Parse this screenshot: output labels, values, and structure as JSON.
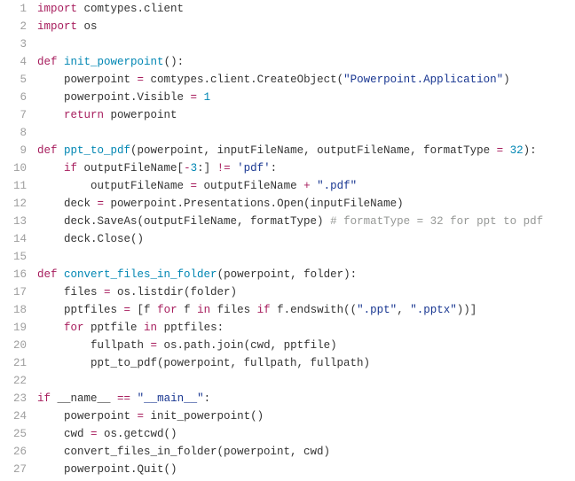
{
  "lines": [
    {
      "num": "1",
      "tokens": [
        [
          "kw",
          "import"
        ],
        [
          "ident",
          " comtypes.client"
        ]
      ]
    },
    {
      "num": "2",
      "tokens": [
        [
          "kw",
          "import"
        ],
        [
          "ident",
          " os"
        ]
      ]
    },
    {
      "num": "3",
      "tokens": []
    },
    {
      "num": "4",
      "tokens": [
        [
          "kw",
          "def"
        ],
        [
          "ident",
          " "
        ],
        [
          "fn",
          "init_powerpoint"
        ],
        [
          "ident",
          "():"
        ]
      ]
    },
    {
      "num": "5",
      "tokens": [
        [
          "ident",
          "    powerpoint "
        ],
        [
          "cmp",
          "="
        ],
        [
          "ident",
          " comtypes.client.CreateObject("
        ],
        [
          "str",
          "\"Powerpoint.Application\""
        ],
        [
          "ident",
          ")"
        ]
      ]
    },
    {
      "num": "6",
      "tokens": [
        [
          "ident",
          "    powerpoint.Visible "
        ],
        [
          "cmp",
          "="
        ],
        [
          "ident",
          " "
        ],
        [
          "num",
          "1"
        ]
      ]
    },
    {
      "num": "7",
      "tokens": [
        [
          "ident",
          "    "
        ],
        [
          "kw",
          "return"
        ],
        [
          "ident",
          " powerpoint"
        ]
      ]
    },
    {
      "num": "8",
      "tokens": []
    },
    {
      "num": "9",
      "tokens": [
        [
          "kw",
          "def"
        ],
        [
          "ident",
          " "
        ],
        [
          "fn",
          "ppt_to_pdf"
        ],
        [
          "ident",
          "(powerpoint, inputFileName, outputFileName, formatType "
        ],
        [
          "cmp",
          "="
        ],
        [
          "ident",
          " "
        ],
        [
          "num",
          "32"
        ],
        [
          "ident",
          "):"
        ]
      ]
    },
    {
      "num": "10",
      "tokens": [
        [
          "ident",
          "    "
        ],
        [
          "kw",
          "if"
        ],
        [
          "ident",
          " outputFileName["
        ],
        [
          "cmp",
          "-"
        ],
        [
          "num",
          "3"
        ],
        [
          "ident",
          ":] "
        ],
        [
          "cmp",
          "!="
        ],
        [
          "ident",
          " "
        ],
        [
          "str",
          "'pdf'"
        ],
        [
          "ident",
          ":"
        ]
      ]
    },
    {
      "num": "11",
      "tokens": [
        [
          "ident",
          "        outputFileName "
        ],
        [
          "cmp",
          "="
        ],
        [
          "ident",
          " outputFileName "
        ],
        [
          "cmp",
          "+"
        ],
        [
          "ident",
          " "
        ],
        [
          "str",
          "\".pdf\""
        ]
      ]
    },
    {
      "num": "12",
      "tokens": [
        [
          "ident",
          "    deck "
        ],
        [
          "cmp",
          "="
        ],
        [
          "ident",
          " powerpoint.Presentations.Open(inputFileName)"
        ]
      ]
    },
    {
      "num": "13",
      "tokens": [
        [
          "ident",
          "    deck.SaveAs(outputFileName, formatType) "
        ],
        [
          "cmt",
          "# formatType = 32 for ppt to pdf"
        ]
      ]
    },
    {
      "num": "14",
      "tokens": [
        [
          "ident",
          "    deck.Close()"
        ]
      ]
    },
    {
      "num": "15",
      "tokens": []
    },
    {
      "num": "16",
      "tokens": [
        [
          "kw",
          "def"
        ],
        [
          "ident",
          " "
        ],
        [
          "fn",
          "convert_files_in_folder"
        ],
        [
          "ident",
          "(powerpoint, folder):"
        ]
      ]
    },
    {
      "num": "17",
      "tokens": [
        [
          "ident",
          "    files "
        ],
        [
          "cmp",
          "="
        ],
        [
          "ident",
          " os.listdir(folder)"
        ]
      ]
    },
    {
      "num": "18",
      "tokens": [
        [
          "ident",
          "    pptfiles "
        ],
        [
          "cmp",
          "="
        ],
        [
          "ident",
          " [f "
        ],
        [
          "kw",
          "for"
        ],
        [
          "ident",
          " f "
        ],
        [
          "kw",
          "in"
        ],
        [
          "ident",
          " files "
        ],
        [
          "kw",
          "if"
        ],
        [
          "ident",
          " f.endswith(("
        ],
        [
          "str",
          "\".ppt\""
        ],
        [
          "ident",
          ", "
        ],
        [
          "str",
          "\".pptx\""
        ],
        [
          "ident",
          "))]"
        ]
      ]
    },
    {
      "num": "19",
      "tokens": [
        [
          "ident",
          "    "
        ],
        [
          "kw",
          "for"
        ],
        [
          "ident",
          " pptfile "
        ],
        [
          "kw",
          "in"
        ],
        [
          "ident",
          " pptfiles:"
        ]
      ]
    },
    {
      "num": "20",
      "tokens": [
        [
          "ident",
          "        fullpath "
        ],
        [
          "cmp",
          "="
        ],
        [
          "ident",
          " os.path.join(cwd, pptfile)"
        ]
      ]
    },
    {
      "num": "21",
      "tokens": [
        [
          "ident",
          "        ppt_to_pdf(powerpoint, fullpath, fullpath)"
        ]
      ]
    },
    {
      "num": "22",
      "tokens": []
    },
    {
      "num": "23",
      "tokens": [
        [
          "kw",
          "if"
        ],
        [
          "ident",
          " __name__ "
        ],
        [
          "cmp",
          "=="
        ],
        [
          "ident",
          " "
        ],
        [
          "str",
          "\"__main__\""
        ],
        [
          "ident",
          ":"
        ]
      ]
    },
    {
      "num": "24",
      "tokens": [
        [
          "ident",
          "    powerpoint "
        ],
        [
          "cmp",
          "="
        ],
        [
          "ident",
          " init_powerpoint()"
        ]
      ]
    },
    {
      "num": "25",
      "tokens": [
        [
          "ident",
          "    cwd "
        ],
        [
          "cmp",
          "="
        ],
        [
          "ident",
          " os.getcwd()"
        ]
      ]
    },
    {
      "num": "26",
      "tokens": [
        [
          "ident",
          "    convert_files_in_folder(powerpoint, cwd)"
        ]
      ]
    },
    {
      "num": "27",
      "tokens": [
        [
          "ident",
          "    powerpoint.Quit()"
        ]
      ]
    }
  ]
}
